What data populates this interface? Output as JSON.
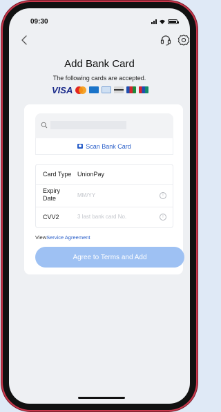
{
  "status_bar": {
    "time": "09:30"
  },
  "header": {
    "title": "Add Bank Card",
    "subtitle": "The following cards are accepted.",
    "card_brands": [
      "VISA",
      "Mastercard",
      "card-brand-3",
      "card-brand-4",
      "card-brand-5",
      "JCB",
      "UnionPay"
    ]
  },
  "search": {
    "placeholder": "",
    "value": ""
  },
  "scan": {
    "label": "Scan Bank Card"
  },
  "form": {
    "card_type": {
      "label": "Card Type",
      "value": "UnionPay"
    },
    "expiry": {
      "label_line1": "Expiry",
      "label_line2": "Date",
      "placeholder": "MM/YY"
    },
    "cvv": {
      "label": "CVV2",
      "placeholder": "3 last bank card No."
    }
  },
  "agreement": {
    "prefix": "View",
    "link": "Service Agreement"
  },
  "submit": {
    "label": "Agree to Terms and Add"
  },
  "colors": {
    "accent": "#2a5fc9",
    "button": "#9ec1f3",
    "frame": "#c9374c"
  }
}
